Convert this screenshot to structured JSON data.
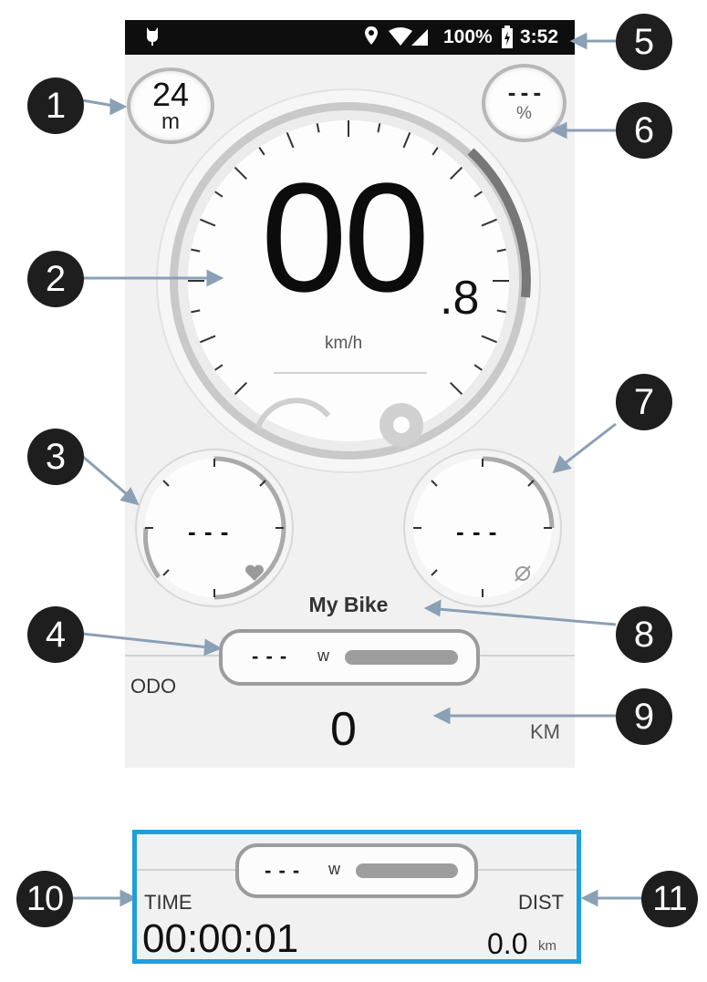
{
  "status_bar": {
    "battery": "100%",
    "time": "3:52"
  },
  "altitude": {
    "value": "24",
    "unit": "m"
  },
  "incline": {
    "value": "- - -",
    "unit": "%"
  },
  "speed": {
    "integer": "00",
    "decimal": ".8",
    "unit": "km/h"
  },
  "heart_rate": {
    "value": "- - -"
  },
  "cadence": {
    "value": "- - -"
  },
  "bike_name": "My Bike",
  "power": {
    "value": "- - -",
    "unit": "w"
  },
  "odometer": {
    "label": "ODO",
    "value": "0",
    "unit": "KM"
  },
  "trip": {
    "time_label": "TIME",
    "time_value": "00:00:01",
    "dist_label": "DIST",
    "dist_value": "0.0",
    "dist_unit": "km",
    "power_value": "- - -",
    "power_unit": "w"
  },
  "callouts": [
    "1",
    "2",
    "3",
    "4",
    "5",
    "6",
    "7",
    "8",
    "9",
    "10",
    "11"
  ],
  "colors": {
    "highlight_border": "#1e9fdc",
    "callout_bg": "#1e1e1e",
    "arrow": "#8aa0b5"
  }
}
